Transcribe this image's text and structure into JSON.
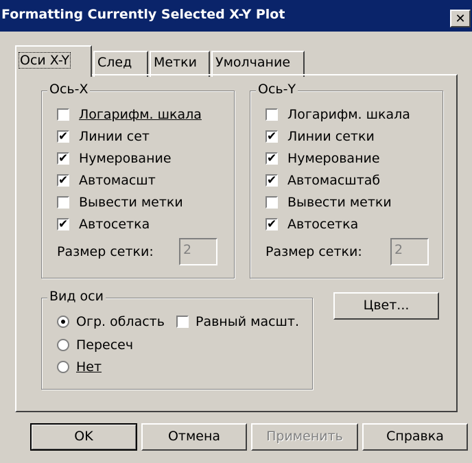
{
  "window": {
    "title": "Formatting Currently Selected X-Y Plot",
    "close": "✕"
  },
  "tabs": [
    "Оси X-Y",
    "След",
    "Метки",
    "Умолчание"
  ],
  "axis_x": {
    "legend": "Ось-X",
    "options": [
      {
        "label": "Логарифм. шкала",
        "checked": false
      },
      {
        "label": "Линии сет",
        "checked": true
      },
      {
        "label": "Нумерование",
        "checked": true
      },
      {
        "label": "Автомасшт",
        "checked": true
      },
      {
        "label": "Вывести метки",
        "checked": false
      },
      {
        "label": "Автосетка",
        "checked": true
      }
    ],
    "grid_label": "Размер сетки:",
    "grid_value": "2"
  },
  "axis_y": {
    "legend": "Ось-Y",
    "options": [
      {
        "label": "Логарифм. шкала",
        "checked": false
      },
      {
        "label": "Линии сетки",
        "checked": true
      },
      {
        "label": "Нумерование",
        "checked": true
      },
      {
        "label": "Автомасштаб",
        "checked": true
      },
      {
        "label": "Вывести метки",
        "checked": false
      },
      {
        "label": "Автосетка",
        "checked": true
      }
    ],
    "grid_label": "Размер сетки:",
    "grid_value": "2"
  },
  "axis_view": {
    "legend": "Вид оси",
    "radios": [
      {
        "label": "Огр. область",
        "selected": true
      },
      {
        "label": "Пересеч",
        "selected": false
      },
      {
        "label": "Нет",
        "selected": false
      }
    ],
    "equal_scale": {
      "label": "Равный масшт.",
      "checked": false
    }
  },
  "color_button": "Цвет...",
  "buttons": {
    "ok": "OK",
    "cancel": "Отмена",
    "apply": "Применить",
    "help": "Справка"
  },
  "check_mark": "✔"
}
